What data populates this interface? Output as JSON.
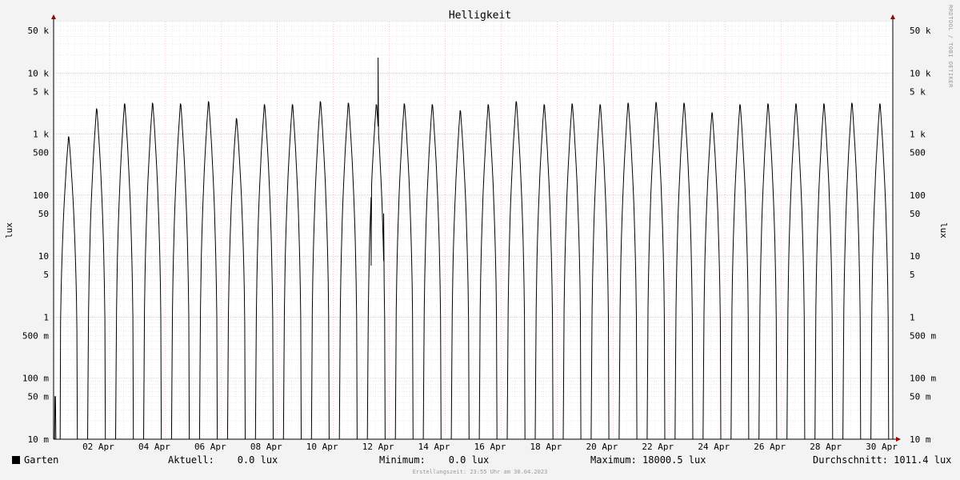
{
  "chart_data": {
    "type": "line",
    "title": "Helligkeit",
    "ylabel": "lux",
    "yscale": "log",
    "ylim": [
      10,
      70000
    ],
    "xlim_days": [
      0,
      30
    ],
    "grid": true,
    "x_tick_labels": [
      "02 Apr",
      "04 Apr",
      "06 Apr",
      "08 Apr",
      "10 Apr",
      "12 Apr",
      "14 Apr",
      "16 Apr",
      "18 Apr",
      "20 Apr",
      "22 Apr",
      "24 Apr",
      "26 Apr",
      "28 Apr",
      "30 Apr"
    ],
    "y_ticks": [
      {
        "label": "10 m",
        "value": 0.01
      },
      {
        "label": "50 m",
        "value": 0.05
      },
      {
        "label": "100 m",
        "value": 0.1
      },
      {
        "label": "500 m",
        "value": 0.5
      },
      {
        "label": "1",
        "value": 1
      },
      {
        "label": "5",
        "value": 5
      },
      {
        "label": "10",
        "value": 10
      },
      {
        "label": "50",
        "value": 50
      },
      {
        "label": "100",
        "value": 100
      },
      {
        "label": "500",
        "value": 500
      },
      {
        "label": "1 k",
        "value": 1000
      },
      {
        "label": "5 k",
        "value": 5000
      },
      {
        "label": "10 k",
        "value": 10000
      },
      {
        "label": "50 k",
        "value": 50000
      }
    ],
    "series": [
      {
        "name": "Garten",
        "daily_max_lux": [
          1000,
          2900,
          3500,
          3600,
          3500,
          3800,
          2000,
          3400,
          3400,
          3800,
          3600,
          3400,
          3500,
          3400,
          2700,
          3400,
          3800,
          3400,
          3500,
          3400,
          3600,
          3700,
          3600,
          2500,
          3400,
          3500,
          3500,
          3500,
          3600,
          3500
        ]
      }
    ],
    "events": [
      {
        "day": 11.35,
        "lux": 7
      },
      {
        "day": 11.6,
        "lux": 18000
      },
      {
        "day": 11.8,
        "lux": 50
      }
    ]
  },
  "legend": {
    "series_name": "Garten",
    "current": "Aktuell:    0.0 lux",
    "minimum": "Minimum:    0.0 lux",
    "maximum": "Maximum: 18000.5 lux",
    "average": "Durchschnitt: 1011.4 lux"
  },
  "footer": "Erstellungszeit: 23:55 Uhr am 30.04.2023",
  "watermark": "RRDTOOL / TOBI OETIKER",
  "colors": {
    "line": "#000000",
    "grid_major": "#f0a0a0",
    "grid_minor": "#d0d0d0",
    "axis": "#000000",
    "arrow": "#a00000",
    "background": "#f3f3f3",
    "plot_bg": "#ffffff"
  }
}
